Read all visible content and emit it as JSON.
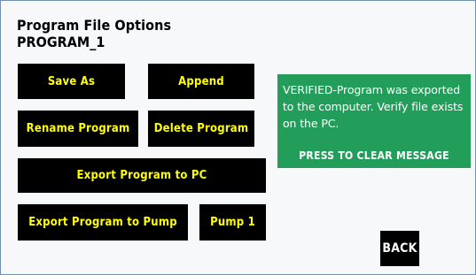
{
  "screen": {
    "title": "Program File Options",
    "program_name": "PROGRAM_1"
  },
  "buttons": {
    "save_as": "Save As",
    "append": "Append",
    "rename_program": "Rename Program",
    "delete_program": "Delete Program",
    "export_to_pc": "Export Program to PC",
    "export_to_pump": "Export Program to Pump",
    "pump_select": "Pump 1",
    "back": "BACK"
  },
  "message": {
    "text": "VERIFIED-Program was exported to the computer. Verify file exists on the PC.",
    "action": "PRESS TO CLEAR MESSAGE"
  },
  "colors": {
    "button_bg": "#000000",
    "button_text": "#ffff00",
    "message_bg": "#229e5a",
    "message_text": "#ffffff"
  }
}
